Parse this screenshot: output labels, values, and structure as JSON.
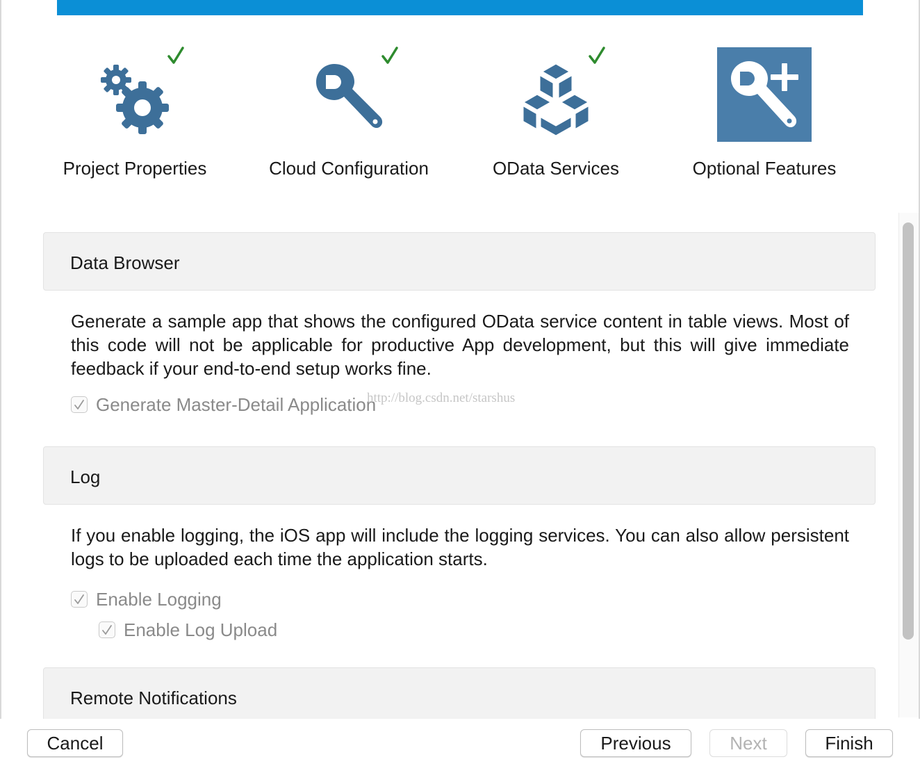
{
  "wizard": {
    "steps": [
      {
        "label": "Project Properties",
        "completed": true,
        "icon": "gears-icon"
      },
      {
        "label": "Cloud Configuration",
        "completed": true,
        "icon": "wrench-icon"
      },
      {
        "label": "OData Services",
        "completed": true,
        "icon": "cubes-icon"
      },
      {
        "label": "Optional Features",
        "completed": false,
        "current": true,
        "icon": "wrench-plus-icon"
      }
    ],
    "accent_color": "#0b8fd6",
    "icon_color": "#3d6f99",
    "check_color": "#2e8b2e"
  },
  "sections": {
    "data_browser": {
      "title": "Data Browser",
      "description": "Generate a sample app that shows the configured OData service content in table views. Most of this code will not be applicable for productive App development, but this will give immediate feedback if your end-to-end setup works fine.",
      "options": [
        {
          "label": "Generate Master-Detail Application",
          "checked": true,
          "disabled": true
        }
      ]
    },
    "log": {
      "title": "Log",
      "description": "If you enable logging, the iOS app will include the logging services. You can also allow persistent logs to be uploaded each time the application starts.",
      "options": [
        {
          "label": "Enable Logging",
          "checked": true,
          "disabled": true
        },
        {
          "label": "Enable Log Upload",
          "checked": true,
          "disabled": true
        }
      ]
    },
    "remote_notifications": {
      "title": "Remote Notifications"
    }
  },
  "watermark": "http://blog.csdn.net/starshus",
  "footer": {
    "cancel_label": "Cancel",
    "previous_label": "Previous",
    "next_label": "Next",
    "finish_label": "Finish",
    "next_disabled": true
  }
}
